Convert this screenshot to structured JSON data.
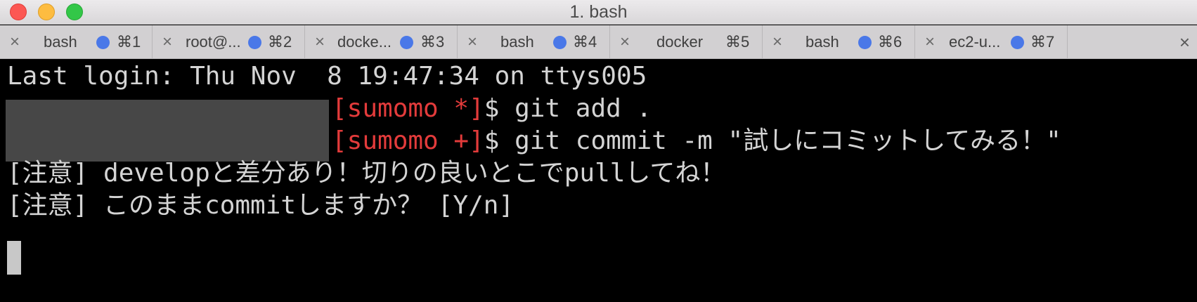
{
  "window": {
    "title": "1. bash"
  },
  "tabs": [
    {
      "title": "bash",
      "shortcut": "⌘1"
    },
    {
      "title": "root@...",
      "shortcut": "⌘2"
    },
    {
      "title": "docke...",
      "shortcut": "⌘3"
    },
    {
      "title": "bash",
      "shortcut": "⌘4"
    },
    {
      "title": "docker",
      "shortcut": "⌘5"
    },
    {
      "title": "bash",
      "shortcut": "⌘6"
    },
    {
      "title": "ec2-u...",
      "shortcut": "⌘7"
    }
  ],
  "tab_close_glyph": "×",
  "colors": {
    "prompt_branch": "#e33b3b",
    "activity_dot": "#4a78e8",
    "terminal_bg": "#000000",
    "terminal_fg": "#d4d4d4"
  },
  "terminal": {
    "last_login": "Last login: Thu Nov  8 19:47:34 on ttys005",
    "prompt1_branch": "[sumomo *]",
    "prompt1_rest": "$ git add .",
    "prompt2_branch": "[sumomo +]",
    "prompt2_rest": "$ git commit -m \"試しにコミットしてみる！\"",
    "warning1": "[注意] developと差分あり！切りの良いとこでpullしてね！",
    "warning2": "[注意] このままcommitしますか？ [Y/n]"
  }
}
